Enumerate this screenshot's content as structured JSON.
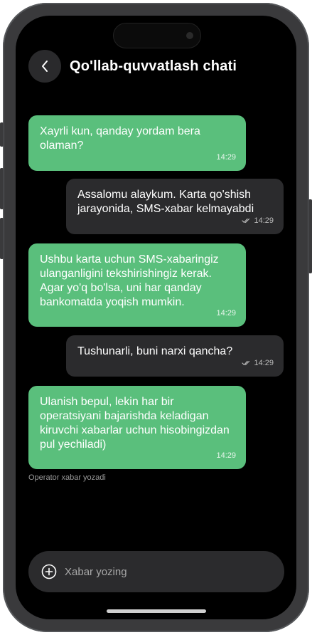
{
  "header": {
    "back_icon": "chevron-left-icon",
    "title": "Qo'llab-quvvatlash chati"
  },
  "messages": [
    {
      "sender": "operator",
      "text": "Xayrli kun, qanday yordam bera olaman?",
      "time": "14:29"
    },
    {
      "sender": "user",
      "text": "Assalomu alaykum. Karta qo'shish jarayonida, SMS-xabar kelmayabdi",
      "time": "14:29",
      "status": "read"
    },
    {
      "sender": "operator",
      "text": "Ushbu karta uchun SMS-xabaringiz ulanganligini tekshirishingiz kerak. Agar yo'q bo'lsa, uni har qanday bankomatda yoqish mumkin.",
      "time": "14:29"
    },
    {
      "sender": "user",
      "text": "Tushunarli, buni narxi qancha?",
      "time": "14:29",
      "status": "read"
    },
    {
      "sender": "operator",
      "text": "Ulanish bepul, lekin har bir operatsiyani bajarishda keladigan kiruvchi xabarlar uchun hisobingizdan pul yechiladi)",
      "time": "14:29"
    }
  ],
  "status": {
    "typing_text": "Operator xabar yozadi"
  },
  "composer": {
    "placeholder": "Xabar yozing",
    "value": "",
    "add_icon": "plus-circle-icon"
  },
  "colors": {
    "operator_bubble": "#5abf7c",
    "user_bubble": "#2b2b2d",
    "background": "#000000"
  }
}
